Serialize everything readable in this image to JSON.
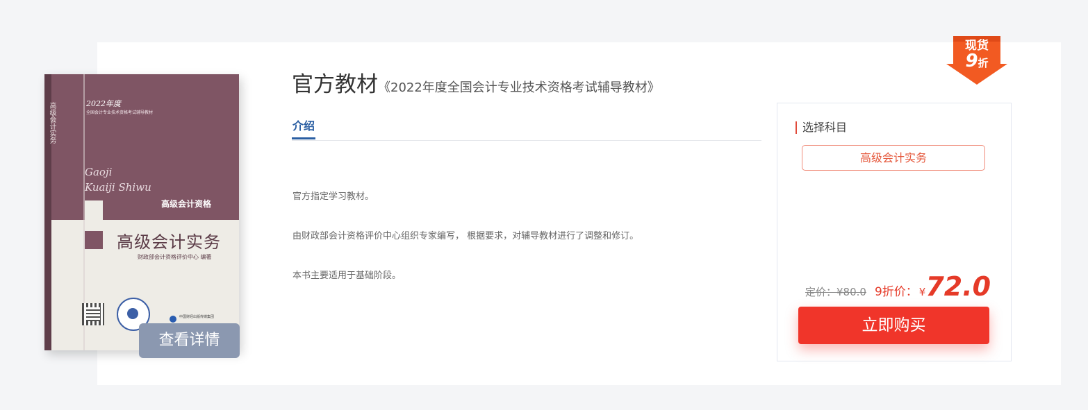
{
  "product": {
    "title_main": "官方教材",
    "title_sub": "《2022年度全国会计专业技术资格考试辅导教材》",
    "view_details": "查看详情"
  },
  "book_cover": {
    "year": "2022年度",
    "series": "全国会计专业技术资格考试辅导教材",
    "pinyin_line1": "Gaoji",
    "pinyin_line2": "Kuaiji Shiwu",
    "level": "高级会计资格",
    "book_title": "高级会计实务",
    "publisher": "财政部会计资格评价中心 编著",
    "spine_text": "高级会计实务",
    "press": "中国财经出版传媒集团"
  },
  "tabs": [
    {
      "label": "介绍"
    }
  ],
  "description": [
    "官方指定学习教材。",
    "由财政部会计资格评价中心组织专家编写， 根据要求，对辅导教材进行了调整和修订。",
    "本书主要适用于基础阶段。"
  ],
  "purchase": {
    "select_subject_label": "选择科目",
    "subject_option": "高级会计实务",
    "original_price_label": "定价：¥80.0",
    "discount_label": "9折价：",
    "currency": "¥",
    "price": "72.0",
    "buy_button": "立即购买"
  },
  "ribbon": {
    "line1": "现货",
    "discount_num": "9",
    "discount_unit": "折"
  },
  "colors": {
    "accent_red": "#f0352a",
    "tab_blue": "#2a5ea2",
    "view_button": "#8b98b0",
    "book_maroon": "#7f5564"
  }
}
